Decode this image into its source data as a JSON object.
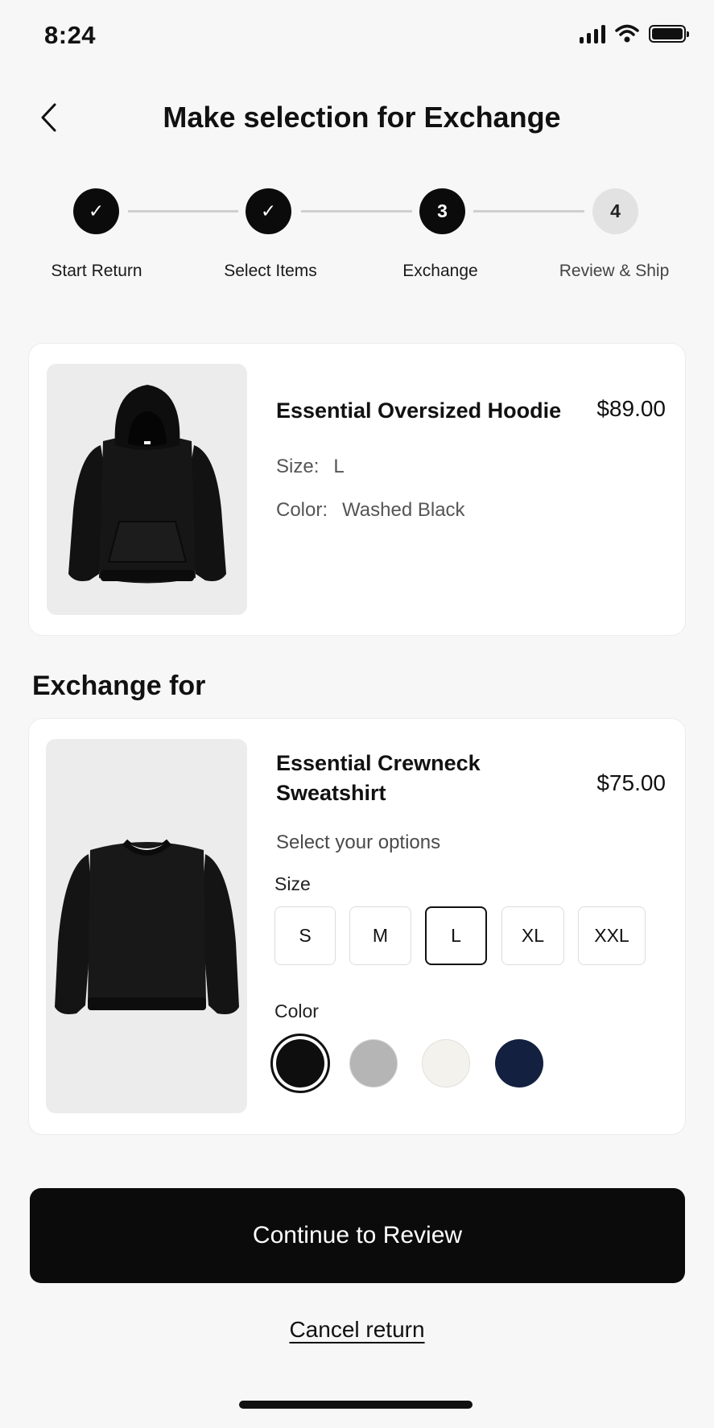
{
  "status_bar": {
    "time": "8:24",
    "icons": [
      "signal-icon",
      "wifi-icon",
      "battery-icon"
    ]
  },
  "header": {
    "title": "Make selection for Exchange",
    "back_icon": "chevron-left-icon"
  },
  "stepper": {
    "steps": [
      {
        "label": "Start Return",
        "state": "done",
        "marker": "✓"
      },
      {
        "label": "Select Items",
        "state": "done",
        "marker": "✓"
      },
      {
        "label": "Exchange",
        "state": "active",
        "marker": "3"
      },
      {
        "label": "Review & Ship",
        "state": "pending",
        "marker": "4"
      }
    ]
  },
  "original_item": {
    "name": "Essential Oversized Hoodie",
    "price": "$89.00",
    "size_label": "Size:",
    "size_value": "L",
    "color_label": "Color:",
    "color_value": "Washed Black",
    "image": "hoodie-image"
  },
  "exchange": {
    "section_title": "Exchange for",
    "name": "Essential Crewneck Sweatshirt",
    "price": "$75.00",
    "image": "sweatshirt-image",
    "options_hint": "Select your options",
    "size_label": "Size",
    "sizes": [
      "S",
      "M",
      "L",
      "XL",
      "XXL"
    ],
    "selected_size": "L",
    "color_label": "Color",
    "colors": [
      "#0e0e0e",
      "#b5b5b5",
      "#f4f2ec",
      "#13203f"
    ],
    "selected_color": "#0e0e0e"
  },
  "actions": {
    "primary": "Continue to Review",
    "secondary": "Cancel return"
  }
}
